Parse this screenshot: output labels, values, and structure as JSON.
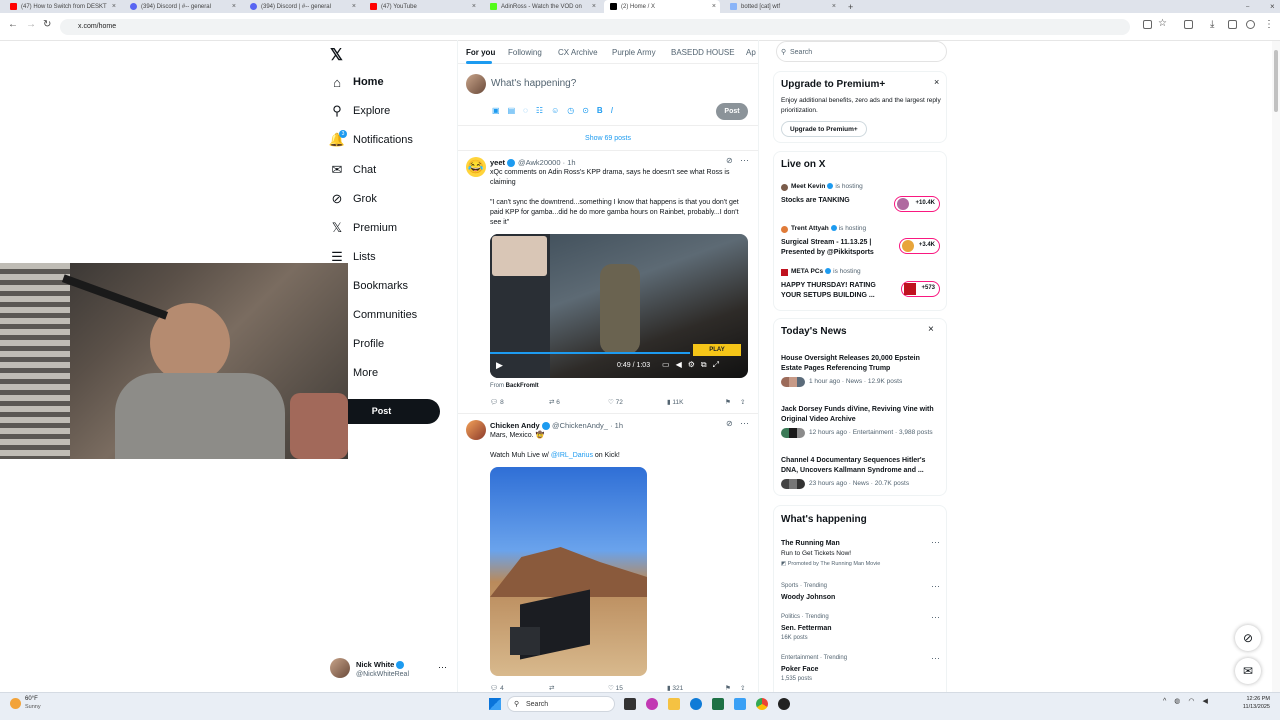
{
  "browser": {
    "tabs": [
      {
        "title": "(47) How to Switch from DESKT",
        "color": "#ff0000"
      },
      {
        "title": "(394) Discord | #-- general",
        "color": "#5865f2"
      },
      {
        "title": "(394) Discord | #-- general",
        "color": "#5865f2"
      },
      {
        "title": "(47) YouTube",
        "color": "#ff0000"
      },
      {
        "title": "AdinRoss - Watch the VOD on",
        "color": "#53fc18"
      },
      {
        "title": "(2) Home / X",
        "color": "#000000"
      },
      {
        "title": "botted [cat] wtf",
        "color": "#8ab4f8"
      }
    ],
    "url": "x.com/home"
  },
  "nav": {
    "items": [
      {
        "label": "Home",
        "icon": "home-icon"
      },
      {
        "label": "Explore",
        "icon": "search-icon"
      },
      {
        "label": "Notifications",
        "icon": "bell-icon",
        "badge": "3"
      },
      {
        "label": "Chat",
        "icon": "mail-icon"
      },
      {
        "label": "Grok",
        "icon": "grok-icon"
      },
      {
        "label": "Premium",
        "icon": "x-logo-icon"
      },
      {
        "label": "Lists",
        "icon": "list-icon"
      },
      {
        "label": "Bookmarks",
        "icon": "bookmark-icon"
      },
      {
        "label": "Communities",
        "icon": "people-icon"
      },
      {
        "label": "Profile",
        "icon": "person-icon"
      },
      {
        "label": "More",
        "icon": "more-icon"
      }
    ],
    "post_label": "Post",
    "user": {
      "name": "Nick White",
      "handle": "@NickWhiteReal"
    }
  },
  "feed": {
    "tabs": [
      "For you",
      "Following",
      "CX Archive",
      "Purple Army",
      "BASEDD HOUSE",
      "Ap"
    ],
    "composer_placeholder": "What's happening?",
    "composer_post": "Post",
    "show_posts": "Show 69 posts",
    "tweets": [
      {
        "name": "yeet",
        "handle": "@Awk20000",
        "time": "· 1h",
        "text1": "xQc comments on Adin Ross's KPP drama, says he doesn't see what Ross is claiming",
        "text2": "\"I can't sync the downtrend...something I know that happens is that you don't get paid KPP for gamba...did he do more gamba hours on Rainbet, probably...I don't see it\"",
        "video_time": "0:49 / 1:03",
        "from_label": "From",
        "from_source": "BackFromIt",
        "replies": "8",
        "reposts": "6",
        "likes": "72",
        "views": "11K"
      },
      {
        "name": "Chicken Andy",
        "handle": "@ChickenAndy_",
        "time": "· 1h",
        "text1": "Mars, Mexico. 🤠",
        "text2_pre": "Watch Muh Live w/",
        "text2_link": "@IRL_Darius",
        "text2_post": "on Kick!",
        "replies": "4",
        "reposts": "",
        "likes": "15",
        "views": "321"
      }
    ]
  },
  "sidebar": {
    "search_placeholder": "Search",
    "premium": {
      "title": "Upgrade to Premium+",
      "body": "Enjoy additional benefits, zero ads and the largest reply prioritization.",
      "button": "Upgrade to Premium+"
    },
    "live": {
      "title": "Live on X",
      "items": [
        {
          "host": "Meet Kevin",
          "status": "is hosting",
          "title": "Stocks are TANKING",
          "count": "+10.4K"
        },
        {
          "host": "Trent Attyah",
          "status": "is hosting",
          "title": "Surgical Stream - 11.13.25 | Presented by @Pikkitsports",
          "count": "+3.4K"
        },
        {
          "host": "META PCs",
          "status": "is hosting",
          "title": "HAPPY THURSDAY! RATING YOUR SETUPS BUILDING ...",
          "count": "+573"
        }
      ]
    },
    "news": {
      "title": "Today's News",
      "items": [
        {
          "headline": "House Oversight Releases 20,000 Epstein Estate Pages Referencing Trump",
          "meta": "1 hour ago · News · 12.9K posts"
        },
        {
          "headline": "Jack Dorsey Funds diVine, Reviving Vine with Original Video Archive",
          "meta": "12 hours ago · Entertainment · 3,988 posts"
        },
        {
          "headline": "Channel 4 Documentary Sequences Hitler's DNA, Uncovers Kallmann Syndrome and ...",
          "meta": "23 hours ago · News · 20.7K posts"
        }
      ]
    },
    "happening": {
      "title": "What's happening",
      "items": [
        {
          "context": "",
          "topic": "The Running Man",
          "sub": "Run to Get Tickets Now!",
          "promo": "Promoted by The Running Man Movie"
        },
        {
          "context": "Sports · Trending",
          "topic": "Woody Johnson",
          "sub": "",
          "promo": ""
        },
        {
          "context": "Politics · Trending",
          "topic": "Sen. Fetterman",
          "sub": "16K posts",
          "promo": ""
        },
        {
          "context": "Entertainment · Trending",
          "topic": "Poker Face",
          "sub": "1,535 posts",
          "promo": ""
        }
      ]
    }
  },
  "taskbar": {
    "weather_temp": "60°F",
    "weather_desc": "Sunny",
    "search": "Search",
    "time": "12:26 PM",
    "date": "11/13/2025"
  }
}
